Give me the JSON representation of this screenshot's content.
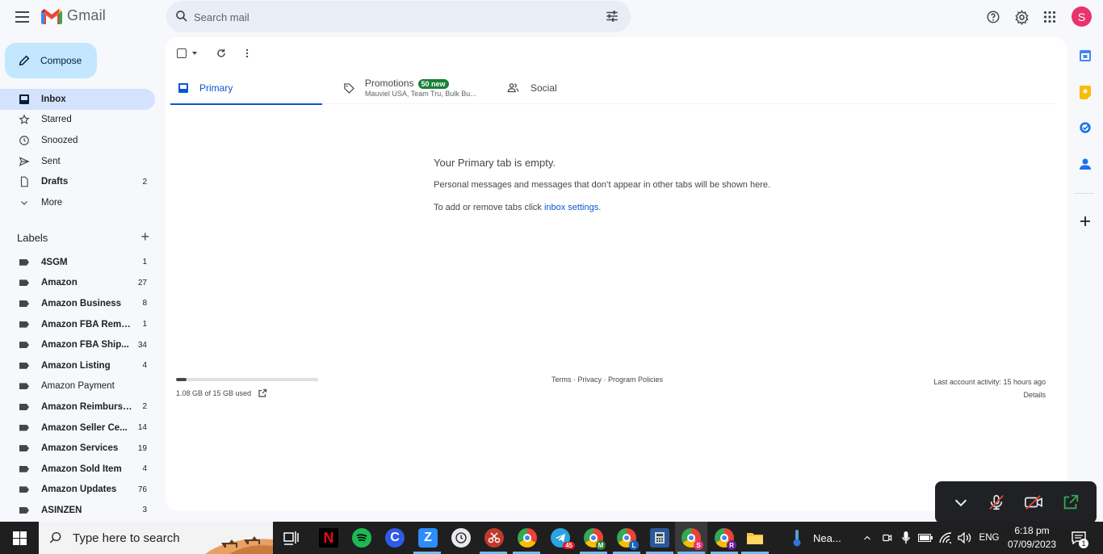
{
  "app": {
    "name": "Gmail"
  },
  "search": {
    "placeholder": "Search mail"
  },
  "user": {
    "avatar_initial": "S"
  },
  "compose": {
    "label": "Compose"
  },
  "nav": [
    {
      "label": "Inbox",
      "count": ""
    },
    {
      "label": "Starred",
      "count": ""
    },
    {
      "label": "Snoozed",
      "count": ""
    },
    {
      "label": "Sent",
      "count": ""
    },
    {
      "label": "Drafts",
      "count": "2"
    },
    {
      "label": "More",
      "count": ""
    }
  ],
  "labels_title": "Labels",
  "labels": [
    {
      "label": "4SGM",
      "count": "1"
    },
    {
      "label": "Amazon",
      "count": "27"
    },
    {
      "label": "Amazon Business",
      "count": "8"
    },
    {
      "label": "Amazon FBA Remo...",
      "count": "1"
    },
    {
      "label": "Amazon FBA Ship...",
      "count": "34"
    },
    {
      "label": "Amazon Listing",
      "count": "4"
    },
    {
      "label": "Amazon Payment",
      "count": ""
    },
    {
      "label": "Amazon Reimburse...",
      "count": "2"
    },
    {
      "label": "Amazon Seller Ce...",
      "count": "14"
    },
    {
      "label": "Amazon Services",
      "count": "19"
    },
    {
      "label": "Amazon Sold Item",
      "count": "4"
    },
    {
      "label": "Amazon Updates",
      "count": "76"
    },
    {
      "label": "ASINZEN",
      "count": "3"
    }
  ],
  "tabs": {
    "primary": "Primary",
    "promotions": "Promotions",
    "promotions_badge": "50 new",
    "promotions_senders": "Mauviel USA, Team Tru, Bulk Bu...",
    "social": "Social"
  },
  "empty_state": {
    "title": "Your Primary tab is empty.",
    "line1": "Personal messages and messages that don’t appear in other tabs will be shown here.",
    "line2_prefix": "To add or remove tabs click ",
    "line2_link": "inbox settings",
    "line2_suffix": "."
  },
  "storage": {
    "text": "1.08 GB of 15 GB used",
    "used_fraction": 0.072
  },
  "footer": {
    "terms": "Terms",
    "privacy": "Privacy",
    "policies": "Program Policies",
    "separator": " · ",
    "activity": "Last account activity: 15 hours ago",
    "details": "Details"
  },
  "taskbar": {
    "search_placeholder": "Type here to search",
    "telegram_badge": "45",
    "chrome_m": "M",
    "chrome_l": "L",
    "chrome_s": "S",
    "chrome_r": "R",
    "weather": "Nea...",
    "language": "ENG",
    "time": "6:18 pm",
    "date": "07/09/2023",
    "notifications": "1"
  },
  "colors": {
    "accent": "#0b57d0",
    "compose_bg": "#c2e7ff",
    "active_nav_bg": "#d3e3fd",
    "badge_green": "#188038",
    "avatar": "#e8336f"
  }
}
